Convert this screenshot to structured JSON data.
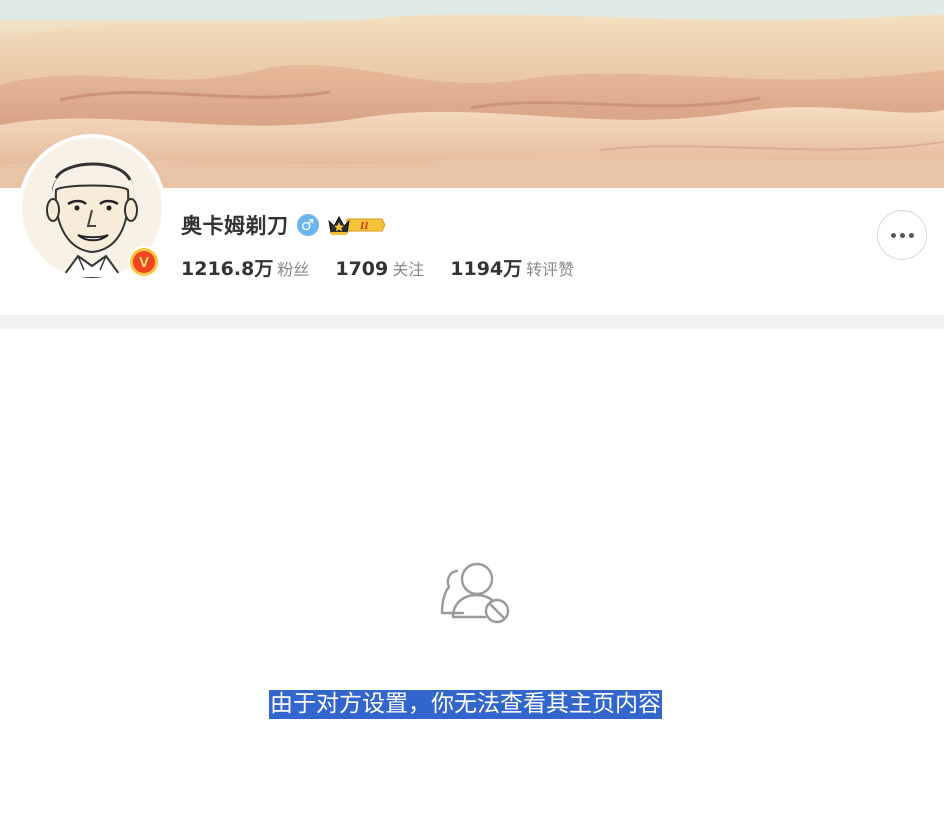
{
  "profile": {
    "name": "奥卡姆剃刀",
    "gender_symbol": "♂",
    "member_level": "II",
    "verified_mark": "V",
    "stats": [
      {
        "value": "1216.8万",
        "label": "粉丝"
      },
      {
        "value": "1709",
        "label": "关注"
      },
      {
        "value": "1194万",
        "label": "转评赞"
      }
    ]
  },
  "empty_state": {
    "message": "由于对方设置，你无法查看其主页内容",
    "icon": "user-blocked-icon"
  },
  "icons": {
    "more": "more-dots-icon",
    "gender": "male-icon",
    "crown": "crown-icon"
  },
  "colors": {
    "gender_blue": "#6cb4ee",
    "verified_orange": "#f0451e",
    "verified_gold": "#f6c744",
    "selection_blue": "#3366cc",
    "divider": "#f2f2f5"
  }
}
